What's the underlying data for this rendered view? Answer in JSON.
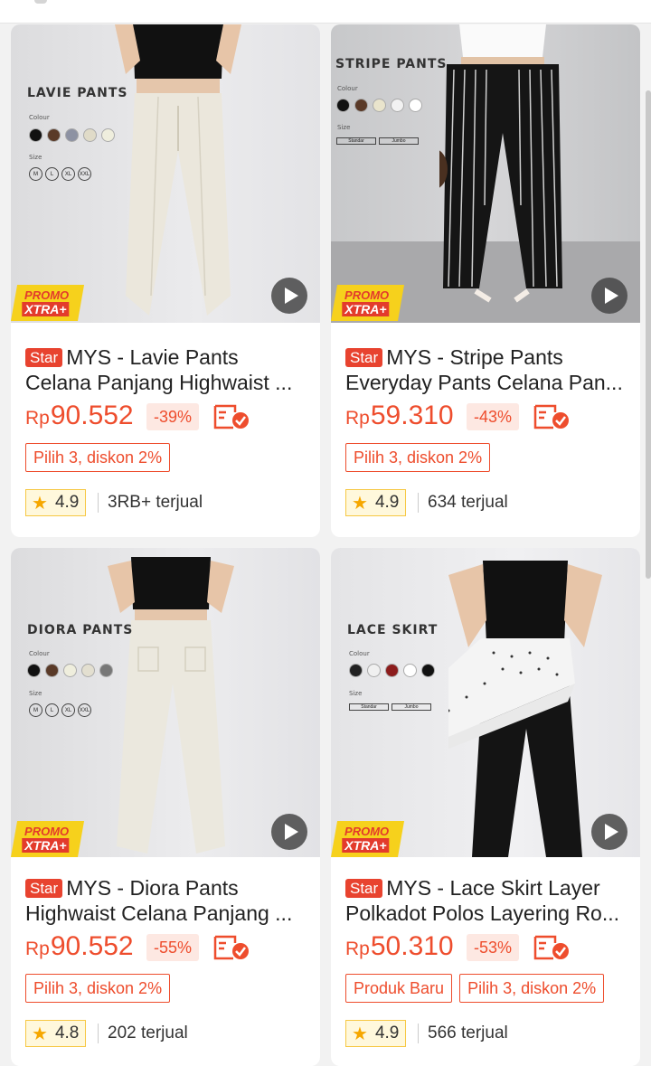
{
  "colors": {
    "accent": "#ee4d2d",
    "star_badge": "#e8432f",
    "promo_yellow": "#f6d11c",
    "rating_star": "#f6a700"
  },
  "products": [
    {
      "image_label": "LAVIE PANTS",
      "colour_text": "Colour",
      "size_text": "Size",
      "size_options": [
        "M",
        "L",
        "XL",
        "XXL"
      ],
      "swatches": [
        "#111111",
        "#5a3a28",
        "#8d92a3",
        "#e0dbc8",
        "#efeedd"
      ],
      "promo_top": "PROMO",
      "promo_bottom": "XTRA+",
      "play_icon": "play-icon",
      "badge": "Star",
      "title_line1": "MYS - Lavie Pants",
      "title_line2": "Celana Panjang Highwaist ...",
      "currency": "Rp",
      "price": "90.552",
      "discount": "-39%",
      "tags": [
        "Pilih 3, diskon 2%"
      ],
      "rating": "4.9",
      "sold": "3RB+ terjual"
    },
    {
      "image_label": "STRIPE PANTS",
      "colour_text": "Colour",
      "size_text": "Size",
      "size_options": [
        "Standar",
        "Jumbo"
      ],
      "swatches": [
        "#111111",
        "#5a3a28",
        "#e9e4cc",
        "#f2f2f2",
        "#ffffff"
      ],
      "promo_top": "PROMO",
      "promo_bottom": "XTRA+",
      "play_icon": "play-icon",
      "badge": "Star",
      "title_line1": "MYS - Stripe Pants",
      "title_line2": "Everyday Pants Celana Pan...",
      "currency": "Rp",
      "price": "59.310",
      "discount": "-43%",
      "tags": [
        "Pilih 3, diskon 2%"
      ],
      "rating": "4.9",
      "sold": "634 terjual"
    },
    {
      "image_label": "DIORA PANTS",
      "colour_text": "Colour",
      "size_text": "Size",
      "size_options": [
        "M",
        "L",
        "XL",
        "XXL"
      ],
      "swatches": [
        "#111111",
        "#5a3a28",
        "#efeedd",
        "#e3dfd0",
        "#777777"
      ],
      "promo_top": "PROMO",
      "promo_bottom": "XTRA+",
      "play_icon": "play-icon",
      "badge": "Star",
      "title_line1": "MYS - Diora Pants",
      "title_line2": "Highwaist Celana Panjang ...",
      "currency": "Rp",
      "price": "90.552",
      "discount": "-55%",
      "tags": [
        "Pilih 3, diskon 2%"
      ],
      "rating": "4.8",
      "sold": "202 terjual"
    },
    {
      "image_label": "LACE SKIRT",
      "colour_text": "Colour",
      "size_text": "Size",
      "size_options": [
        "Standar",
        "Jumbo"
      ],
      "swatches": [
        "#222222",
        "#f0f0f0",
        "#8c1c1c",
        "#ffffff",
        "#111111"
      ],
      "promo_top": "PROMO",
      "promo_bottom": "XTRA+",
      "play_icon": "play-icon",
      "badge": "Star",
      "title_line1": "MYS - Lace Skirt Layer",
      "title_line2": "Polkadot Polos Layering Ro...",
      "currency": "Rp",
      "price": "50.310",
      "discount": "-53%",
      "tags": [
        "Produk Baru",
        "Pilih 3, diskon 2%"
      ],
      "rating": "4.9",
      "sold": "566 terjual"
    }
  ]
}
